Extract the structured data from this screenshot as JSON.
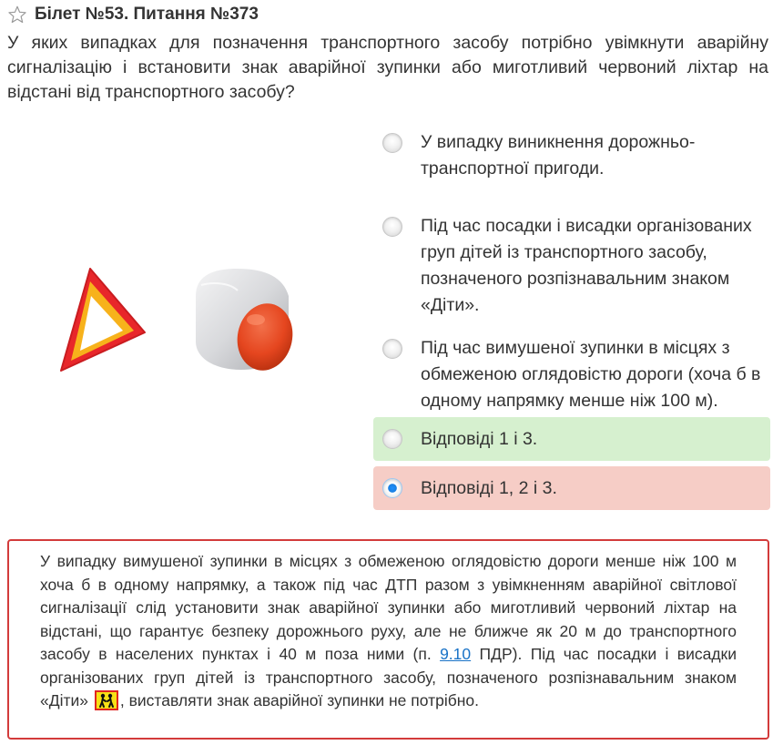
{
  "header": {
    "title": "Білет №53. Питання №373",
    "star_icon": "star-outline-icon"
  },
  "question": {
    "text": "У яких випадках для позначення транспортного засобу потрібно увімкнути аварійну сигналізацію і встановити знак аварійної зупинки або миготливий червоний ліхтар на відстані від транспортного засобу?"
  },
  "illustration": {
    "items": [
      "warning-triangle-icon",
      "red-flashing-lamp-icon"
    ],
    "colors": {
      "triangle_outer": "#e8262a",
      "triangle_inner": "#f7b21b",
      "lamp_body": "#d9dadd",
      "lamp_lens": "#e6461e"
    }
  },
  "answers": [
    {
      "text": "У випадку виникнення дорожньо-транспортної пригоди.",
      "state": "none",
      "checked": false
    },
    {
      "text": "Під час посадки і висадки організованих груп дітей із транспортного засобу, позначеного розпізнавальним знаком «Діти».",
      "state": "none",
      "checked": false
    },
    {
      "text": "Під час вимушеної зупинки в місцях з обмеженою оглядовістю дороги (хоча б в одному напрямку менше ніж 100 м).",
      "state": "none",
      "checked": false
    },
    {
      "text": "Відповіді 1 і 3.",
      "state": "correct",
      "checked": false
    },
    {
      "text": "Відповіді 1, 2 і 3.",
      "state": "wrong",
      "checked": true
    }
  ],
  "explanation": {
    "text_before": "У випадку вимушеної зупинки в місцях з обмеженою оглядовістю дороги менше ніж 100 м хоча б в одному напрямку, а також під час ДТП разом з увімкненням аварійної світлової сигналізації слід установити знак аварійної зупинки або миготливий червоний ліхтар на відстані, що гарантує безпеку дорожнього руху, але не ближче як 20 м до транспортного засобу в населених пунктах і 40 м поза ними (п. ",
    "link": "9.10",
    "text_middle": " ПДР). Під час посадки і висадки організованих груп дітей із транспортного засобу, позначеного розпізнавальним знаком «Діти» ",
    "sign_icon": "children-sign-icon",
    "text_after": ", виставляти знак аварійної зупинки не потрібно.",
    "colors": {
      "border": "#d33b3b",
      "link": "#1a73c7",
      "sign_bg": "#f7e016",
      "sign_border": "#e0261f"
    }
  },
  "colors": {
    "correct_bg": "#d6f0cf",
    "wrong_bg": "#f6cdc6",
    "text": "#333333"
  }
}
